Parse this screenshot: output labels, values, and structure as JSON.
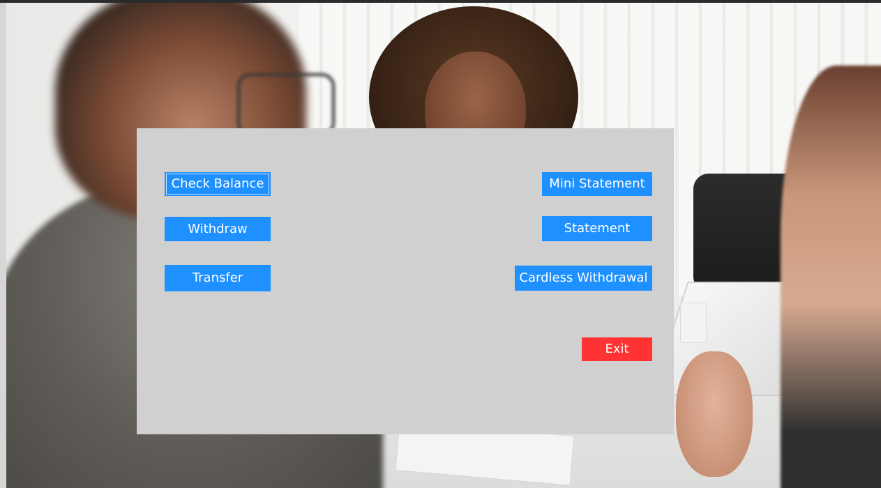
{
  "panel": {
    "buttons": {
      "check_balance": "Check Balance",
      "withdraw": "Withdraw",
      "transfer": "Transfer",
      "mini_statement": "Mini Statement",
      "statement": "Statement",
      "cardless_withdrawal": "Cardless Withdrawal",
      "exit": "Exit"
    }
  },
  "colors": {
    "panel_bg": "#d0d0d0",
    "button_blue": "#1e90ff",
    "button_red": "#ff3333",
    "button_text": "#ffffff"
  }
}
